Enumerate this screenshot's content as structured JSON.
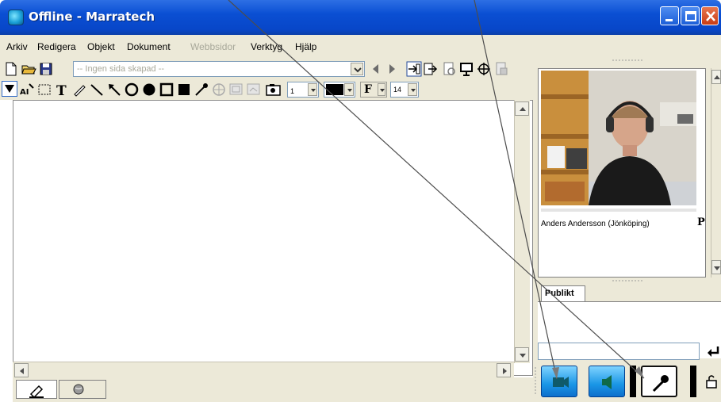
{
  "window": {
    "title": "Offline - Marratech"
  },
  "menu": {
    "items": [
      {
        "label": "Arkiv",
        "enabled": true
      },
      {
        "label": "Redigera",
        "enabled": true
      },
      {
        "label": "Objekt",
        "enabled": true
      },
      {
        "label": "Dokument",
        "enabled": true
      },
      {
        "label": "Webbsidor",
        "enabled": false
      },
      {
        "label": "Verktyg",
        "enabled": true
      },
      {
        "label": "Hjälp",
        "enabled": true
      }
    ]
  },
  "toolbar": {
    "page_select_value": "-- Ingen sida skapad --",
    "line_width_value": "1",
    "font_size_value": "14",
    "font_button_label": "F"
  },
  "video": {
    "participant_name": "Anders Andersson (Jönköping)",
    "badge": "P"
  },
  "audience": {
    "tab_label": "Publikt"
  },
  "chat": {
    "input_value": ""
  },
  "icons": {
    "title": "marratech-logo-icon",
    "enter": "enter-arrow-icon",
    "camera": "camera-icon",
    "speaker": "speaker-icon",
    "microphone": "microphone-icon",
    "edit_tab": "pencil-icon",
    "web_tab": "globe-icon"
  },
  "colors": {
    "title_bar": "#0a4fd3",
    "chrome": "#ece9d8",
    "media_button": "#1a96e6"
  }
}
